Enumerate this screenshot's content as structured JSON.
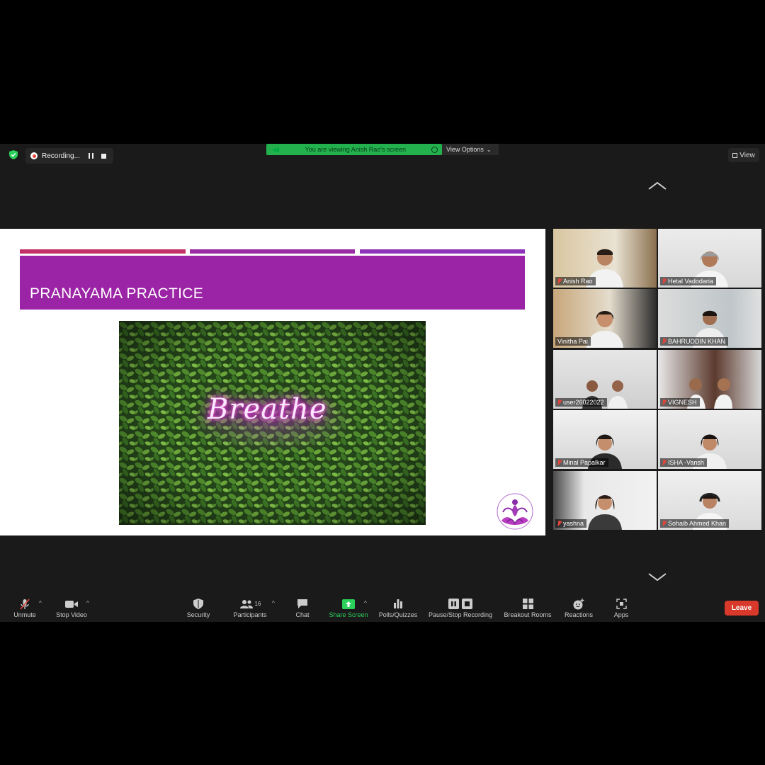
{
  "top_bar": {
    "recording_label": "Recording...",
    "viewing_text": "You are viewing Anish Rao's screen",
    "view_options_label": "View Options",
    "view_label": "View"
  },
  "slide": {
    "title": "PRANAYAMA PRACTICE",
    "image_text": "Breathe"
  },
  "participants": [
    {
      "name": "Anish Rao",
      "muted": true
    },
    {
      "name": "Hetal Vadodaria",
      "muted": true
    },
    {
      "name": "Vinitha Pai",
      "muted": false,
      "active_speaker": true
    },
    {
      "name": "BAHRUDDIN KHAN",
      "muted": true
    },
    {
      "name": "user26022022",
      "muted": true
    },
    {
      "name": "VIGNESH",
      "muted": true
    },
    {
      "name": "Minal Papalkar",
      "muted": true
    },
    {
      "name": "ISHA -Vansh",
      "muted": true
    },
    {
      "name": "yashna",
      "muted": true
    },
    {
      "name": "Sohaib Ahmed Khan",
      "muted": true
    }
  ],
  "toolbar": {
    "unmute": "Unmute",
    "stop_video": "Stop Video",
    "security": "Security",
    "participants": "Participants",
    "participant_count": "16",
    "chat": "Chat",
    "share_screen": "Share Screen",
    "polls": "Polls/Quizzes",
    "pause_stop_recording": "Pause/Stop Recording",
    "breakout_rooms": "Breakout Rooms",
    "reactions": "Reactions",
    "apps": "Apps",
    "leave": "Leave"
  },
  "colors": {
    "title_band": "#9b23a5",
    "viewing_bar": "#22b14c",
    "leave_button": "#d8392b",
    "active_speaker_border": "#d7e24b"
  }
}
